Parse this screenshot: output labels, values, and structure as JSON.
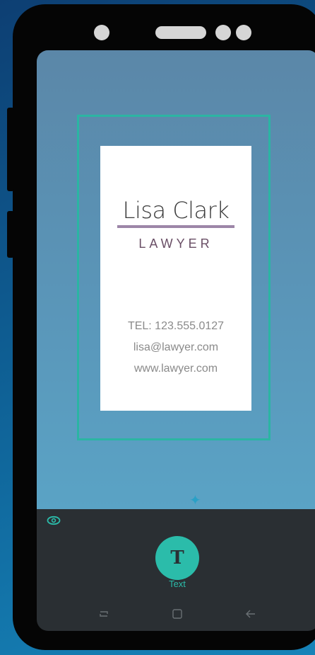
{
  "card": {
    "name": "Lisa Clark",
    "title": "LAWYER",
    "tel": "TEL: 123.555.0127",
    "email": "lisa@lawyer.com",
    "website": "www.lawyer.com"
  },
  "toolbar": {
    "text_button_glyph": "T",
    "text_label": "Text"
  },
  "icons": {
    "visibility": "eye-icon",
    "rotate": "star-icon",
    "recents": "recents-icon",
    "home": "home-icon",
    "back": "back-icon"
  },
  "colors": {
    "accent": "#2bbcaa",
    "name_underline": "#9d86a8",
    "nav_bar": "#2a2f33"
  }
}
